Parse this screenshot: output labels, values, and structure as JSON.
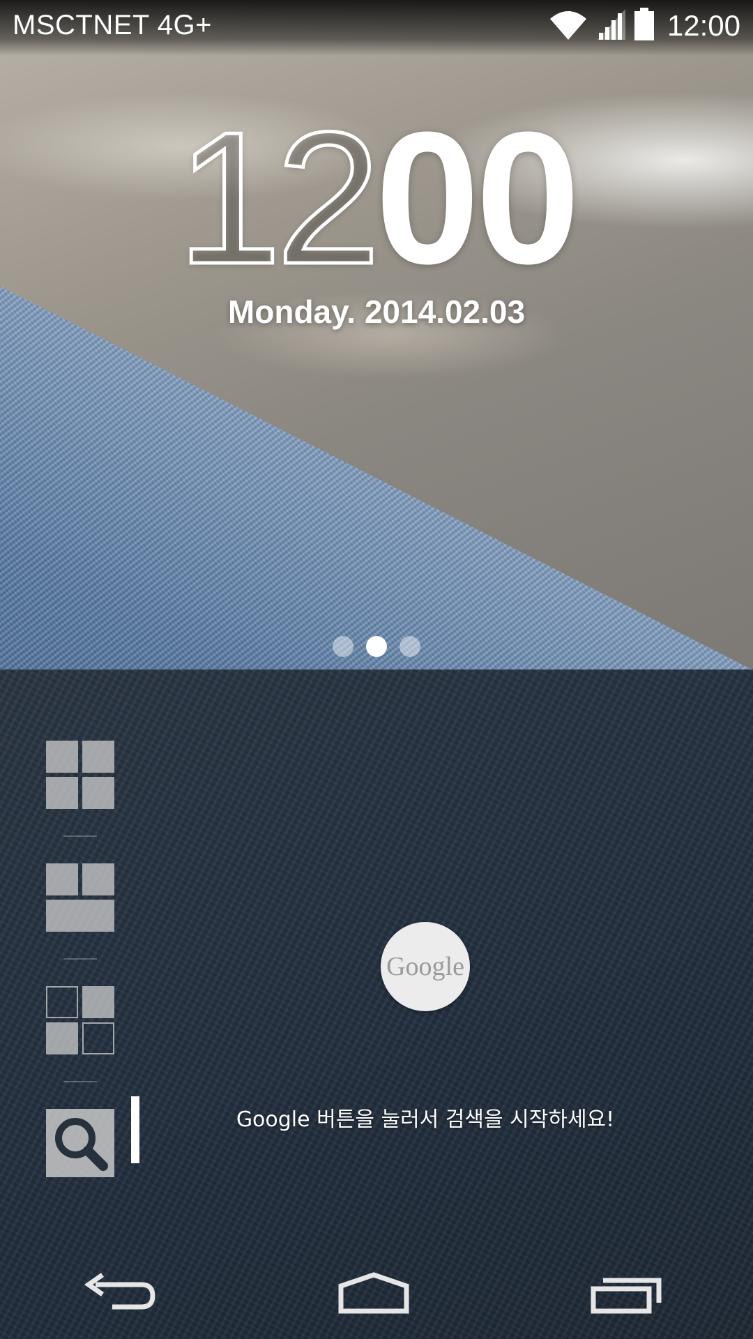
{
  "status_bar": {
    "carrier": "MSCTNET 4G+",
    "time": "12:00",
    "icons": [
      "wifi-icon",
      "signal-icon",
      "battery-icon"
    ]
  },
  "clock": {
    "hours": "12",
    "minutes": "00",
    "date": "Monday. 2014.02.03"
  },
  "pager": {
    "count": 3,
    "active_index": 1
  },
  "panel": {
    "layouts": [
      "layout-grid-four-icon",
      "layout-grid-three-icon",
      "layout-grid-split-icon"
    ],
    "search_icon": "search-icon",
    "google_button_label": "Google",
    "hint": "Google 버튼을 눌러서 검색을 시작하세요!"
  },
  "nav": {
    "icons": [
      "back-icon",
      "home-icon",
      "recents-icon"
    ]
  },
  "colors": {
    "panel_bg": "#233040",
    "icon_gray": "#c8c8c8",
    "text": "#ffffff"
  }
}
